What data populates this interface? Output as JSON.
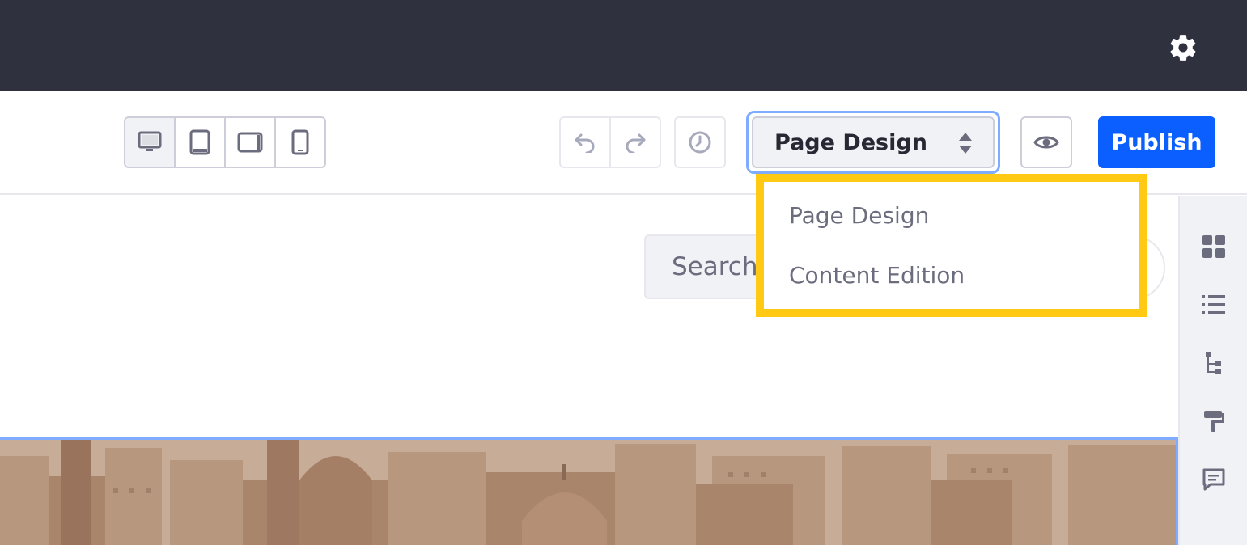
{
  "header": {
    "settings_icon": "gear-icon"
  },
  "toolbar": {
    "devices": [
      {
        "name": "desktop",
        "icon": "desktop-icon",
        "active": true
      },
      {
        "name": "tablet",
        "icon": "tablet-icon",
        "active": false
      },
      {
        "name": "landscape",
        "icon": "tablet-landscape-icon",
        "active": false
      },
      {
        "name": "mobile",
        "icon": "mobile-icon",
        "active": false
      }
    ],
    "undo_icon": "undo-icon",
    "redo_icon": "redo-icon",
    "history_icon": "clock-icon",
    "mode_select": {
      "value": "Page Design",
      "options": [
        "Page Design",
        "Content Edition"
      ]
    },
    "preview_icon": "eye-icon",
    "publish_label": "Publish"
  },
  "canvas": {
    "search_placeholder": "Search...",
    "search_visible_text": "Search."
  },
  "dropdown": {
    "items": [
      {
        "label": "Page Design"
      },
      {
        "label": "Content Edition"
      }
    ]
  },
  "sidebar": {
    "icons": [
      "fragments-icon",
      "list-icon",
      "tree-icon",
      "paint-roller-icon",
      "comment-icon"
    ]
  },
  "colors": {
    "topbar": "#30313f",
    "primary": "#0b5fff",
    "highlight": "#ffc914",
    "focus": "#80acff"
  }
}
